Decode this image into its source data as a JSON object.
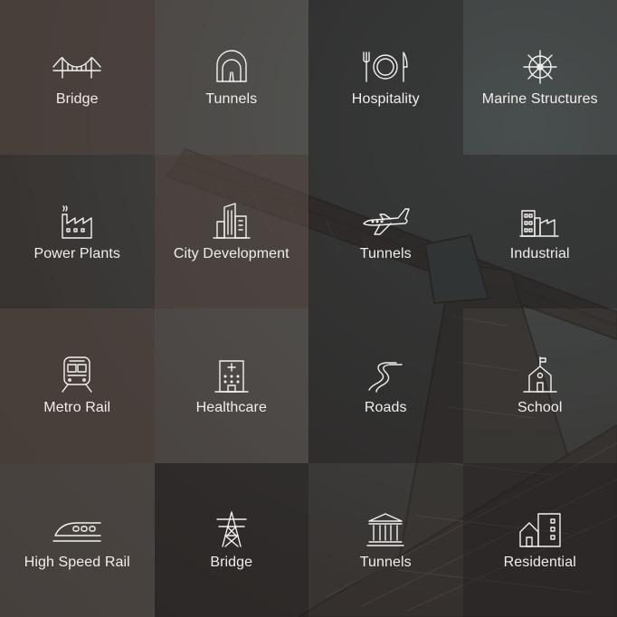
{
  "tiles": [
    {
      "label": "Bridge",
      "icon": "bridge-icon"
    },
    {
      "label": "Tunnels",
      "icon": "tunnel-icon"
    },
    {
      "label": "Hospitality",
      "icon": "plate-cutlery-icon"
    },
    {
      "label": "Marine Structures",
      "icon": "ship-wheel-icon"
    },
    {
      "label": "Power Plants",
      "icon": "factory-icon"
    },
    {
      "label": "City Development",
      "icon": "city-buildings-icon"
    },
    {
      "label": "Tunnels",
      "icon": "airplane-icon"
    },
    {
      "label": "Industrial",
      "icon": "industrial-buildings-icon"
    },
    {
      "label": "Metro Rail",
      "icon": "metro-train-icon"
    },
    {
      "label": "Healthcare",
      "icon": "hospital-icon"
    },
    {
      "label": "Roads",
      "icon": "winding-road-icon"
    },
    {
      "label": "School",
      "icon": "school-icon"
    },
    {
      "label": "High Speed Rail",
      "icon": "bullet-train-icon"
    },
    {
      "label": "Bridge",
      "icon": "transmission-tower-icon"
    },
    {
      "label": "Tunnels",
      "icon": "museum-columns-icon"
    },
    {
      "label": "Residential",
      "icon": "house-building-icon"
    }
  ]
}
